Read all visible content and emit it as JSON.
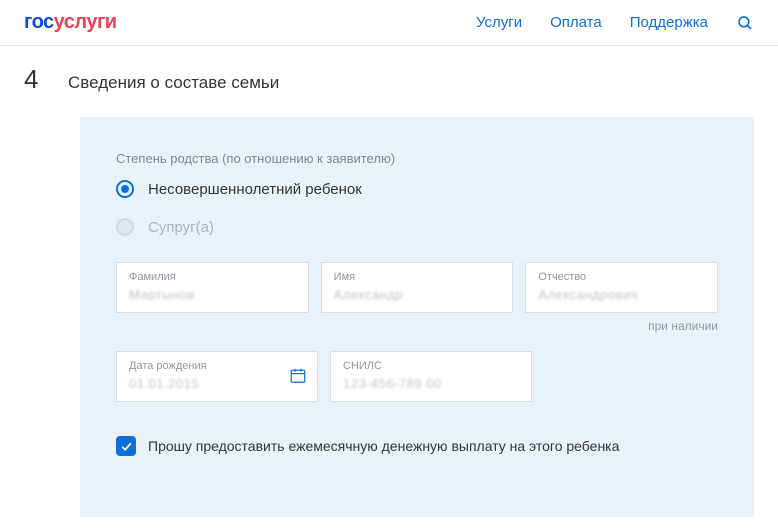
{
  "header": {
    "logo_part1": "гос",
    "logo_part2": "услуги",
    "nav": {
      "services": "Услуги",
      "payment": "Оплата",
      "support": "Поддержка"
    }
  },
  "step": {
    "number": "4",
    "title": "Сведения о составе семьи"
  },
  "form": {
    "relationship_label": "Степень родства (по отношению к заявителю)",
    "option_child": "Несовершеннолетний ребенок",
    "option_spouse": "Супруг(а)",
    "fields": {
      "surname": {
        "label": "Фамилия",
        "value": "Мартынов"
      },
      "name": {
        "label": "Имя",
        "value": "Александр"
      },
      "patronymic": {
        "label": "Отчество",
        "value": "Александрович"
      },
      "patronymic_hint": "при наличии",
      "birthdate": {
        "label": "Дата рождения",
        "value": "01.01.2015"
      },
      "snils": {
        "label": "СНИЛС",
        "value": "123-456-789 00"
      }
    },
    "checkbox_label": "Прошу предоставить ежемесячную денежную выплату на этого ребенка"
  }
}
